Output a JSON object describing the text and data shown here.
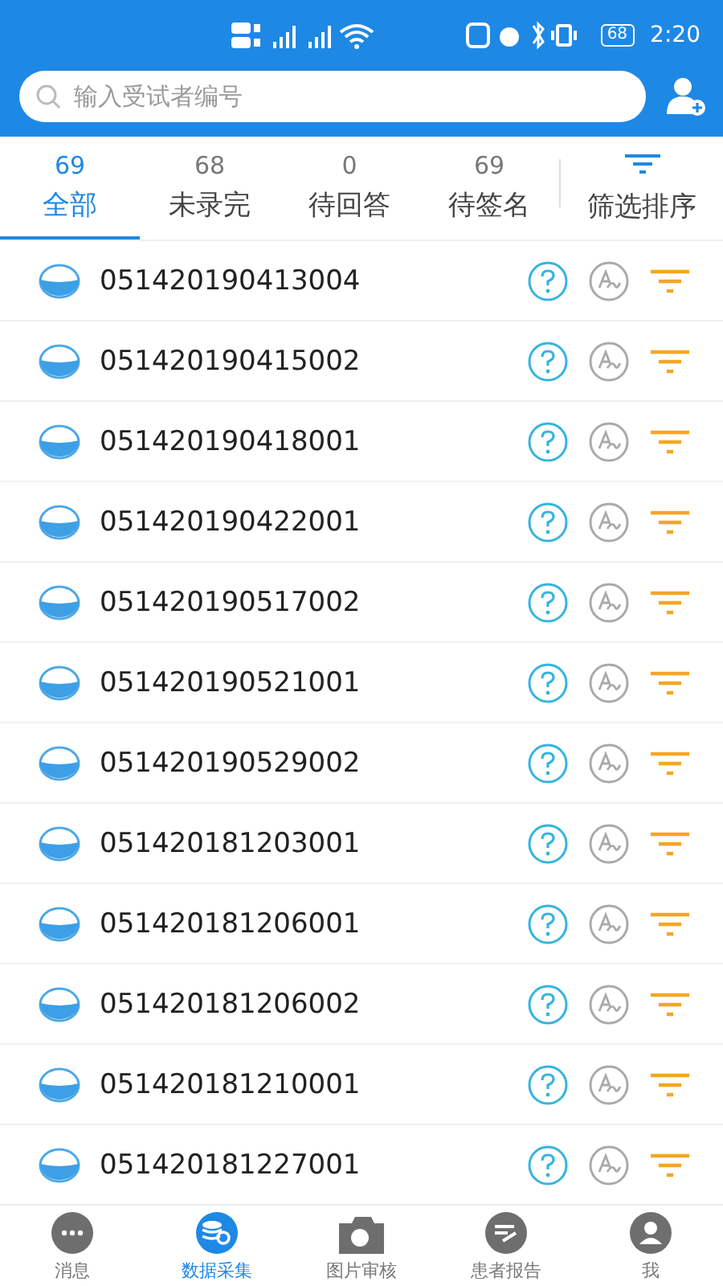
{
  "status_bar": {
    "battery": "68",
    "time": "2:20"
  },
  "search": {
    "placeholder": "输入受试者编号"
  },
  "tabs": [
    {
      "count": "69",
      "label": "全部",
      "selected": true
    },
    {
      "count": "68",
      "label": "未录完",
      "selected": false
    },
    {
      "count": "0",
      "label": "待回答",
      "selected": false
    },
    {
      "count": "69",
      "label": "待签名",
      "selected": false
    }
  ],
  "filter": {
    "label": "筛选排序"
  },
  "subjects": [
    {
      "id": "051420190413004"
    },
    {
      "id": "051420190415002"
    },
    {
      "id": "051420190418001"
    },
    {
      "id": "051420190422001"
    },
    {
      "id": "051420190517002"
    },
    {
      "id": "051420190521001"
    },
    {
      "id": "051420190529002"
    },
    {
      "id": "051420181203001"
    },
    {
      "id": "051420181206001"
    },
    {
      "id": "051420181206002"
    },
    {
      "id": "051420181210001"
    },
    {
      "id": "051420181227001"
    }
  ],
  "bottom_nav": [
    {
      "kind": "message",
      "label": "消息",
      "selected": false
    },
    {
      "kind": "data",
      "label": "数据采集",
      "selected": true
    },
    {
      "kind": "camera",
      "label": "图片审核",
      "selected": false
    },
    {
      "kind": "report",
      "label": "患者报告",
      "selected": false
    },
    {
      "kind": "me",
      "label": "我",
      "selected": false
    }
  ]
}
